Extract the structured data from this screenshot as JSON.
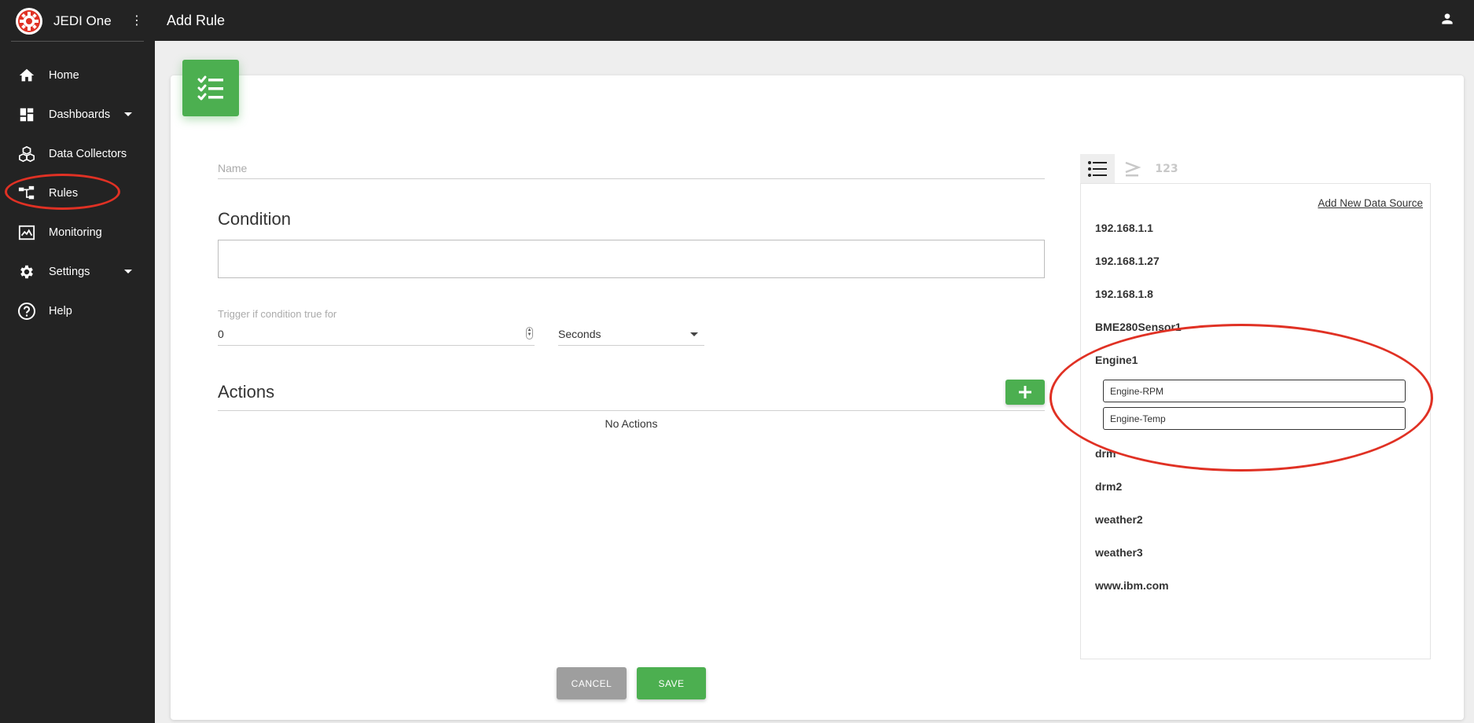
{
  "app": {
    "title": "JEDI One",
    "logo_icon": "gear-logo-icon",
    "accent_color": "#e03124"
  },
  "header": {
    "title": "Add Rule",
    "user_icon": "person-icon"
  },
  "sidebar": {
    "items": [
      {
        "label": "Home",
        "icon": "home-icon"
      },
      {
        "label": "Dashboards",
        "icon": "dashboard-icon"
      },
      {
        "label": "Data Collectors",
        "icon": "cubes-icon"
      },
      {
        "label": "Rules",
        "icon": "rule-tree-icon"
      },
      {
        "label": "Monitoring",
        "icon": "monitor-icon"
      },
      {
        "label": "Settings",
        "icon": "gear-icon"
      },
      {
        "label": "Help",
        "icon": "help-icon"
      }
    ]
  },
  "form": {
    "name_placeholder": "Name",
    "condition_title": "Condition",
    "trigger_label": "Trigger if condition true for",
    "trigger_value": "0",
    "trigger_unit": "Seconds",
    "actions_title": "Actions",
    "no_actions": "No Actions",
    "cancel_label": "CANCEL",
    "save_label": "SAVE",
    "primary_color": "#4caf50"
  },
  "data_panel": {
    "tab3_label": "123",
    "add_source_label": "Add New Data Source",
    "sources": [
      "192.168.1.1",
      "192.168.1.27",
      "192.168.1.8",
      "BME280Sensor1",
      "Engine1",
      "drm",
      "drm2",
      "weather2",
      "weather3",
      "www.ibm.com"
    ],
    "engine1_children": [
      "Engine-RPM",
      "Engine-Temp"
    ]
  }
}
